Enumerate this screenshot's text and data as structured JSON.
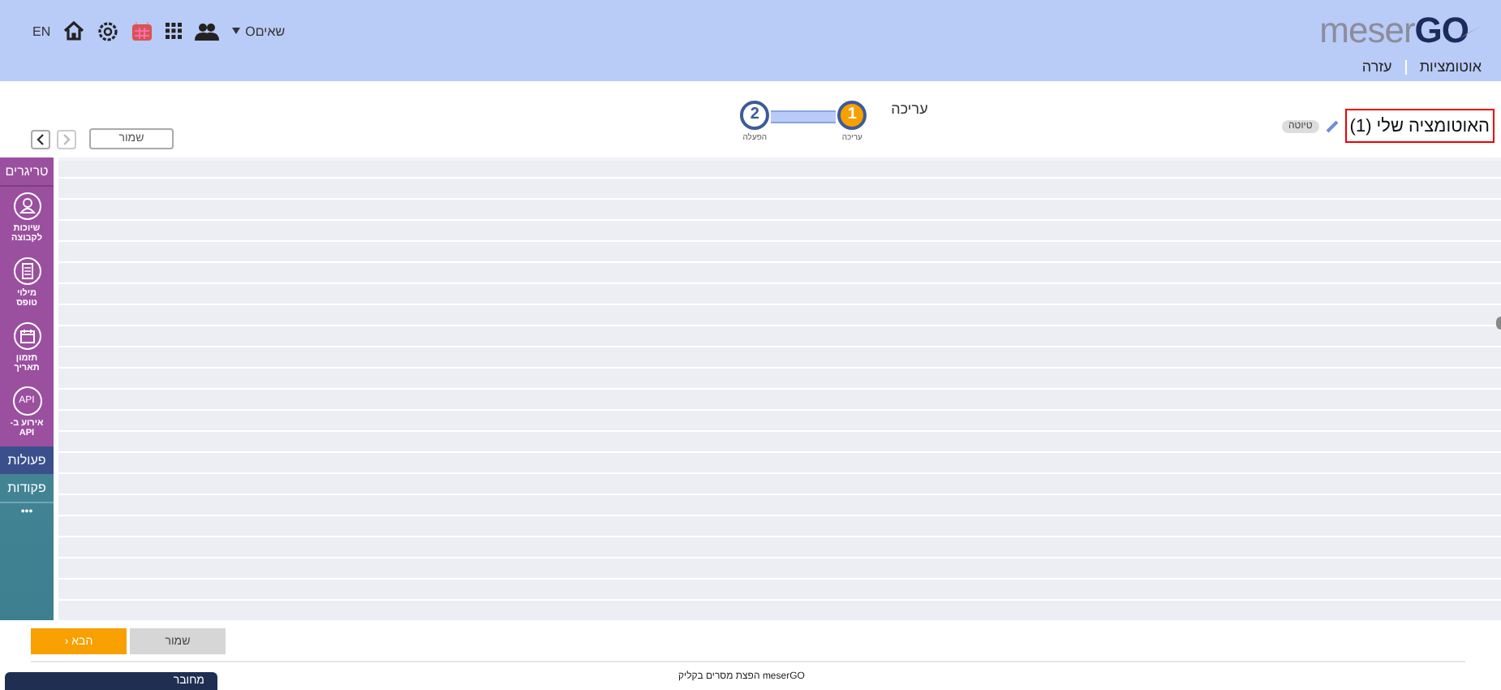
{
  "header": {
    "lang": "EN",
    "user": "Oשאים",
    "logo_light": "meser",
    "logo_bold": "GO",
    "nav": [
      "אוטומציות",
      "עזרה"
    ]
  },
  "toolbar": {
    "title": "האוטומציה שלי (1)",
    "badge": "טיוטה",
    "heading": "עריכה",
    "save": "שמור",
    "steps": [
      {
        "number": "1",
        "label": "עריכה",
        "selected": true
      },
      {
        "number": "2",
        "label": "הפעלה",
        "selected": false
      }
    ]
  },
  "sidebar": {
    "triggers_title": "טריגרים",
    "triggers": [
      {
        "kind": "group",
        "label": "שיוכות לקבוצה"
      },
      {
        "kind": "form",
        "label": "מילוי טופס"
      },
      {
        "kind": "date",
        "label": "תזמון תאריך"
      },
      {
        "kind": "api",
        "label": "אירוע ב-API",
        "icon_text": "API"
      }
    ],
    "actions": "פעולות",
    "commands": "פקודות",
    "more": "•••"
  },
  "buttons": {
    "save": "שמור",
    "next": "הבא",
    "next_icon": "‹"
  },
  "footer": {
    "text": "meserGO הפצת מסרים בקליק",
    "connected": "מחובר"
  }
}
